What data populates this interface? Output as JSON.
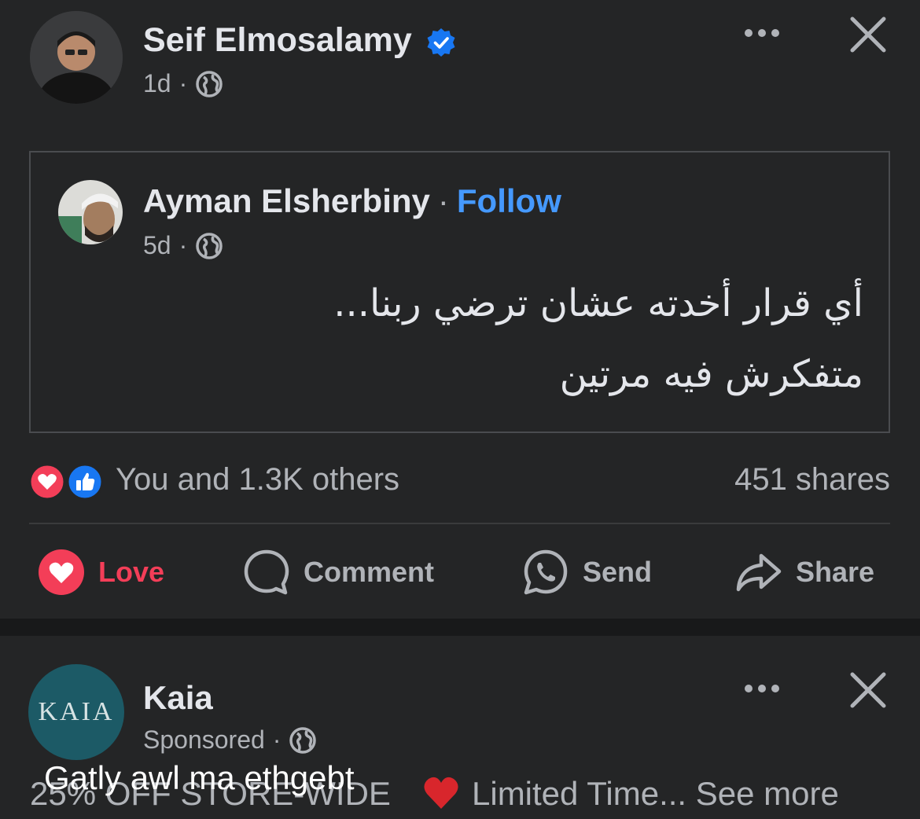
{
  "post": {
    "author": "Seif Elmosalamy",
    "time": "1d",
    "separator": "·"
  },
  "shared": {
    "author": "Ayman Elsherbiny",
    "separator": "·",
    "follow_label": "Follow",
    "time": "5d",
    "text_line1": "أي قرار أخدته عشان ترضي ربنا...",
    "text_line2": "متفكرش فيه مرتين"
  },
  "reactions": {
    "summary": "You and 1.3K others",
    "shares": "451 shares"
  },
  "actions": {
    "love_label": "Love",
    "comment_label": "Comment",
    "send_label": "Send",
    "share_label": "Share"
  },
  "ad": {
    "page_name": "Kaia",
    "logo_text": "KAIA",
    "sponsored_label": "Sponsored",
    "separator": "·",
    "text_behind": "25% OFF STORE-WIDE",
    "text_main": "Limited Time...",
    "see_more": "See more"
  },
  "overlay": {
    "caption": "Gatly awl ma ethgebt"
  },
  "colors": {
    "background": "#242526",
    "accent_blue": "#4599ff",
    "love_red": "#f33e58",
    "like_blue": "#1877f2",
    "text_secondary": "#b0b3b8"
  }
}
